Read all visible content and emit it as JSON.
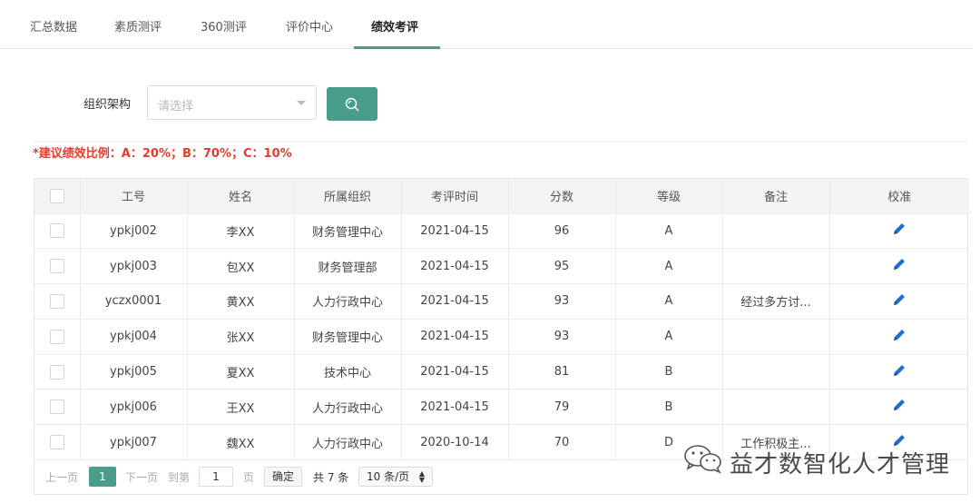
{
  "tabs": [
    {
      "label": "汇总数据"
    },
    {
      "label": "素质测评"
    },
    {
      "label": "360测评"
    },
    {
      "label": "评价中心"
    },
    {
      "label": "绩效考评",
      "active": true
    }
  ],
  "filter": {
    "label": "组织架构",
    "select_placeholder": "请选择"
  },
  "ratio_note": "*建议绩效比例：A：20%；B：70%；C：10%",
  "table": {
    "headers": [
      "工号",
      "姓名",
      "所属组织",
      "考评时间",
      "分数",
      "等级",
      "备注",
      "校准"
    ],
    "rows": [
      {
        "id": "ypkj002",
        "name": "李XX",
        "org": "财务管理中心",
        "date": "2021-04-15",
        "score": "96",
        "grade": "A",
        "note": ""
      },
      {
        "id": "ypkj003",
        "name": "包XX",
        "org": "财务管理部",
        "date": "2021-04-15",
        "score": "95",
        "grade": "A",
        "note": ""
      },
      {
        "id": "yczx0001",
        "name": "黄XX",
        "org": "人力行政中心",
        "date": "2021-04-15",
        "score": "93",
        "grade": "A",
        "note": "经过多方讨..."
      },
      {
        "id": "ypkj004",
        "name": "张XX",
        "org": "财务管理中心",
        "date": "2021-04-15",
        "score": "93",
        "grade": "A",
        "note": ""
      },
      {
        "id": "ypkj005",
        "name": "夏XX",
        "org": "技术中心",
        "date": "2021-04-15",
        "score": "81",
        "grade": "B",
        "note": ""
      },
      {
        "id": "ypkj006",
        "name": "王XX",
        "org": "人力行政中心",
        "date": "2021-04-15",
        "score": "79",
        "grade": "B",
        "note": ""
      },
      {
        "id": "ypkj007",
        "name": "魏XX",
        "org": "人力行政中心",
        "date": "2020-10-14",
        "score": "70",
        "grade": "D",
        "note": "工作积极主..."
      }
    ]
  },
  "pagination": {
    "prev": "上一页",
    "current": "1",
    "next": "下一页",
    "goto": "到第",
    "goto_value": "1",
    "page_unit": "页",
    "confirm": "确定",
    "total": "共 7 条",
    "page_size": "10 条/页"
  },
  "watermark": {
    "text": "益才数智化人才管理"
  },
  "colors": {
    "accent": "#4a9d8a",
    "note_red": "#e23d2d",
    "pencil_blue": "#1f6fd1"
  },
  "icons": {
    "search": "search-icon",
    "edit": "pencil-icon",
    "dropdown": "caret-down-icon",
    "wechat": "wechat-icon"
  }
}
